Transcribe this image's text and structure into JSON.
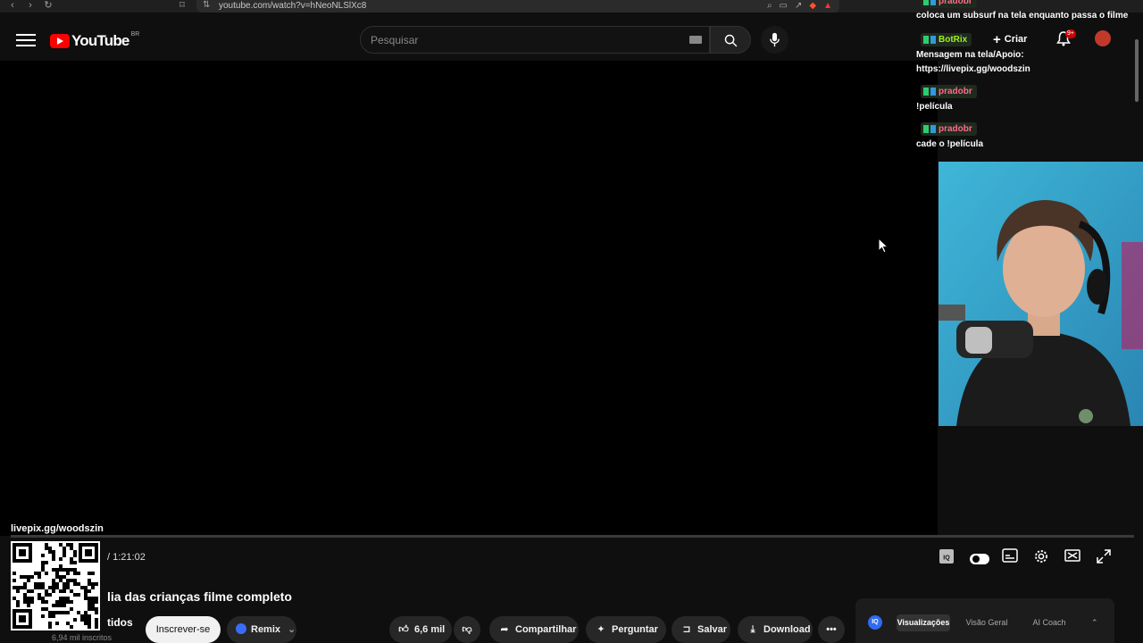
{
  "browser": {
    "url": "youtube.com/watch?v=hNeoNLSlXc8"
  },
  "header": {
    "logo_text": "YouTube",
    "region": "BR",
    "search_placeholder": "Pesquisar",
    "create_label": "Criar",
    "notifications_badge": "9+"
  },
  "player": {
    "time": "/ 1:21:02",
    "progress_fraction": 0.0
  },
  "video": {
    "title": "lia das crianças filme completo",
    "channel_fragment": "tidos",
    "subscribers": "6,94 mil inscritos",
    "subscribe_label": "Inscrever-se",
    "remix_label": "Remix",
    "like_count": "6,6 mil",
    "share_label": "Compartilhar",
    "ask_label": "Perguntar",
    "save_label": "Salvar",
    "download_label": "Download"
  },
  "iq_panel": {
    "logo": "IQ",
    "tabs": [
      "Visualizações",
      "Visão Geral",
      "AI Coach"
    ],
    "active_tab": "Visualizações"
  },
  "stream_overlay": {
    "qr_caption": "livepix.gg/woodszin"
  },
  "chat": {
    "top_message": "coloca um subsurf na tela enquanto passa o filme",
    "top_user": "pradobr",
    "entries": [
      {
        "user": "BotRix",
        "user_color": "#9ef01a",
        "message_lines": [
          "Mensagem na tela/Apoio:",
          "https://livepix.gg/woodszin"
        ]
      },
      {
        "user": "pradobr",
        "user_color": "#ff6b8a",
        "message_lines": [
          "!película"
        ]
      },
      {
        "user": "pradobr",
        "user_color": "#ff6b8a",
        "message_lines": [
          "cade o !película"
        ]
      }
    ]
  },
  "colors": {
    "accent": "#ff0000",
    "background": "#0f0f0f",
    "iq_blue": "#2f6bf3"
  }
}
